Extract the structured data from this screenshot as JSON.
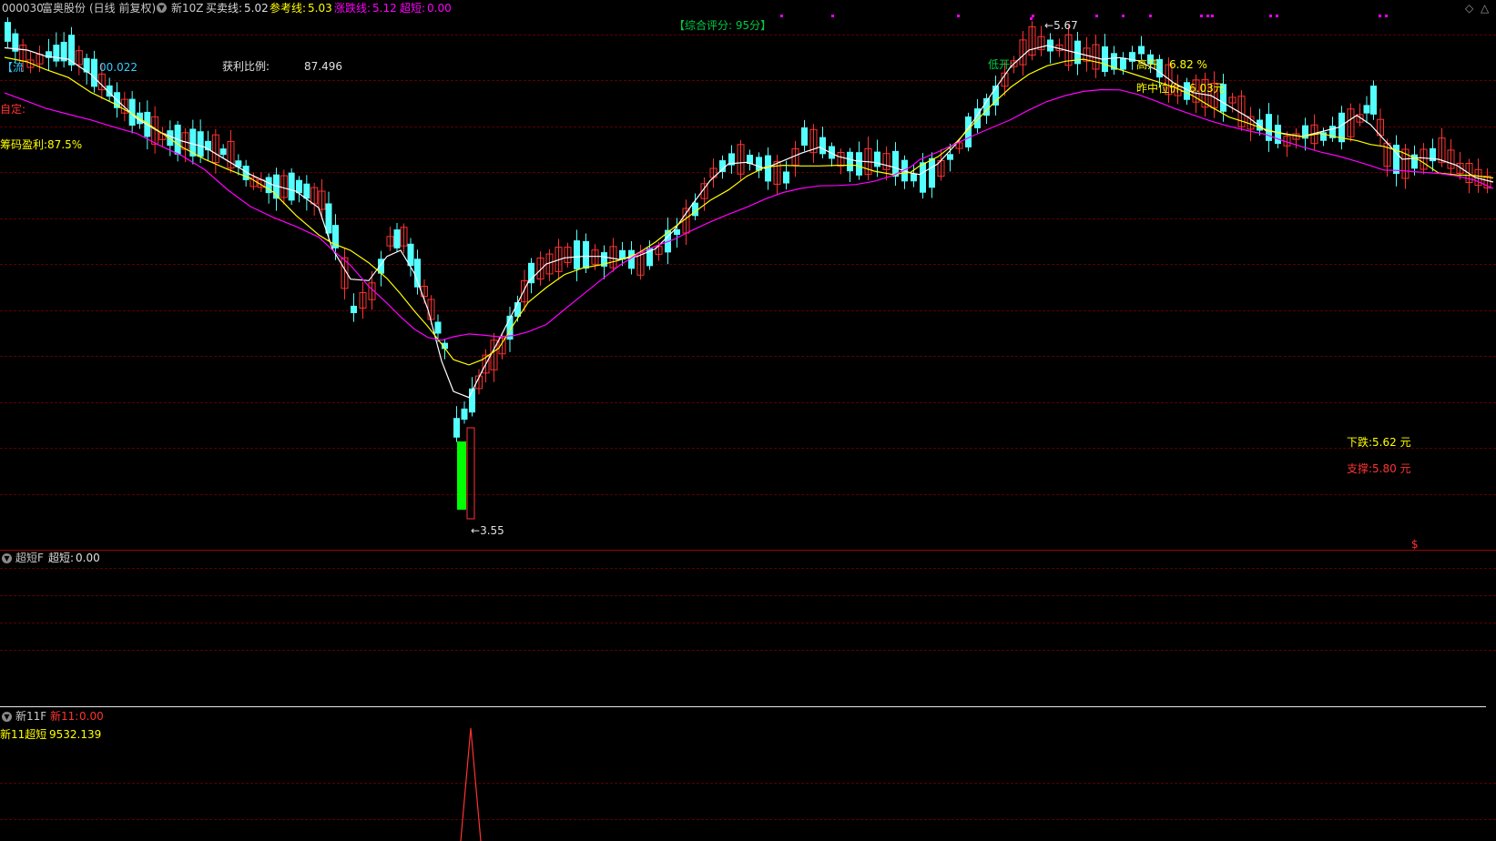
{
  "header": {
    "stock_code": "000030",
    "stock_name": "富奥股份",
    "mode": "(日线 前复权)",
    "indicator": "新10Z",
    "buysell_label": "买卖线:",
    "buysell_value": "5.02",
    "ref_label": "参考线:",
    "ref_value": "5.03",
    "zd_label": "涨跌线:",
    "zd_value": "5.12",
    "cd_label": "超短:",
    "cd_value": "0.00"
  },
  "overlay": {
    "score": "【综合评分: 95分】",
    "liu_label": "【流",
    "liu_value": "00.022",
    "profit_ratio_label": "获利比例:",
    "profit_ratio_value": "87.496",
    "custom_label": "自定:",
    "chip_profit": "筹码盈利:87.5%",
    "high_price": "5.67",
    "low_price": "3.55",
    "low_open": "低开:",
    "high_open": "高开:",
    "high_open_value": "6.82 %",
    "mid_price_label": "昨中位价:",
    "mid_price_value": "6.03元",
    "down_label": "下跌:5.62 元",
    "support_label": "支撑:5.80 元",
    "dollar_sign": "$"
  },
  "panel2": {
    "name": "超短F",
    "value_label": "超短:",
    "value": "0.00"
  },
  "panel3": {
    "name": "新11F",
    "value_label": "新11:",
    "value": "0.00",
    "sub_label": "新11超短",
    "sub_value": "9532.139"
  },
  "colors": {
    "up_candle": "#ff3232",
    "down_candle": "#54ffff",
    "ma_white": "#ffffff",
    "ma_yellow": "#ffff00",
    "ma_magenta": "#ff00ff",
    "signal_green": "#00ff00",
    "grid": "#5a0000"
  },
  "icons": {
    "panel_toggle": "chevron-down-icon",
    "corner_left": "diamond-icon",
    "corner_right": "triangle-icon"
  }
}
